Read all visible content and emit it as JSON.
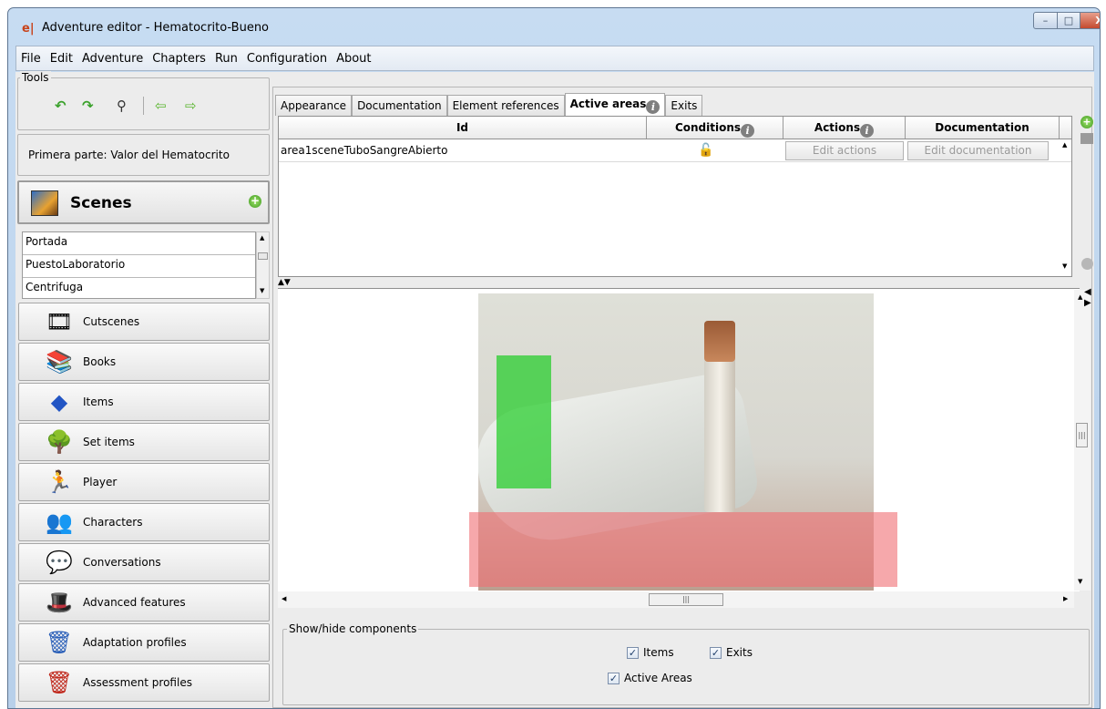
{
  "window": {
    "app_icon": "eAdventure-logo-icon",
    "title": "Adventure editor - Hematocrito-Bueno",
    "controls": {
      "minimize": "–",
      "maximize": "□",
      "close": "X"
    }
  },
  "menubar": [
    "File",
    "Edit",
    "Adventure",
    "Chapters",
    "Run",
    "Configuration",
    "About"
  ],
  "tools": {
    "label": "Tools",
    "buttons": [
      {
        "icon": "undo-icon",
        "glyph": "↶"
      },
      {
        "icon": "redo-icon",
        "glyph": "↷"
      },
      {
        "icon": "search-binoculars-icon",
        "glyph": "⚲"
      },
      {
        "icon": "back-arrow-icon",
        "glyph": "⇦"
      },
      {
        "icon": "forward-arrow-icon",
        "glyph": "⇨"
      }
    ]
  },
  "chapter": "Primera parte: Valor del Hematocrito",
  "scenes": {
    "label": "Scenes",
    "items": [
      "Portada",
      "PuestoLaboratorio",
      "Centrifuga"
    ]
  },
  "nav": [
    {
      "label": "Cutscenes",
      "icon": "cutscenes-film-icon",
      "glyph": "🎞"
    },
    {
      "label": "Books",
      "icon": "books-icon",
      "glyph": "📚"
    },
    {
      "label": "Items",
      "icon": "items-shapes-icon",
      "glyph": "◆"
    },
    {
      "label": "Set items",
      "icon": "set-items-trees-icon",
      "glyph": "🌳"
    },
    {
      "label": "Player",
      "icon": "player-icon",
      "glyph": "🏃"
    },
    {
      "label": "Characters",
      "icon": "characters-icon",
      "glyph": "👥"
    },
    {
      "label": "Conversations",
      "icon": "conversations-bubble-icon",
      "glyph": "💬"
    },
    {
      "label": "Advanced features",
      "icon": "advanced-features-hat-icon",
      "glyph": "🎩"
    },
    {
      "label": "Adaptation profiles",
      "icon": "adaptation-profiles-icon",
      "glyph": "🗑"
    },
    {
      "label": "Assessment profiles",
      "icon": "assessment-profiles-icon",
      "glyph": "🗑"
    }
  ],
  "tabs": [
    {
      "label": "Appearance",
      "active": false
    },
    {
      "label": "Documentation",
      "active": false
    },
    {
      "label": "Element references",
      "active": false
    },
    {
      "label": "Active areas",
      "active": true
    },
    {
      "label": "Exits",
      "active": false
    }
  ],
  "table": {
    "columns": [
      "Id",
      "Conditions",
      "Actions",
      "Documentation"
    ],
    "rows": [
      {
        "id": "area1sceneTuboSangreAbierto",
        "conditions_icon": "padlock-open-icon",
        "actions": "Edit actions",
        "documentation": "Edit documentation"
      }
    ]
  },
  "preview": {
    "image": "gloved-hand-holding-blood-tube-photo",
    "areas": [
      {
        "name": "active-area",
        "color": "#23cd28"
      },
      {
        "name": "exit-area",
        "color": "#f06e73"
      }
    ]
  },
  "showhide": {
    "label": "Show/hide components",
    "items": {
      "checked": true,
      "label": "Items"
    },
    "exits": {
      "checked": true,
      "label": "Exits"
    },
    "active_areas": {
      "checked": true,
      "label": "Active Areas"
    }
  },
  "scroll_glyphs": {
    "up": "▲",
    "down": "▼",
    "left": "◀",
    "right": "▶",
    "grip": "|||"
  }
}
